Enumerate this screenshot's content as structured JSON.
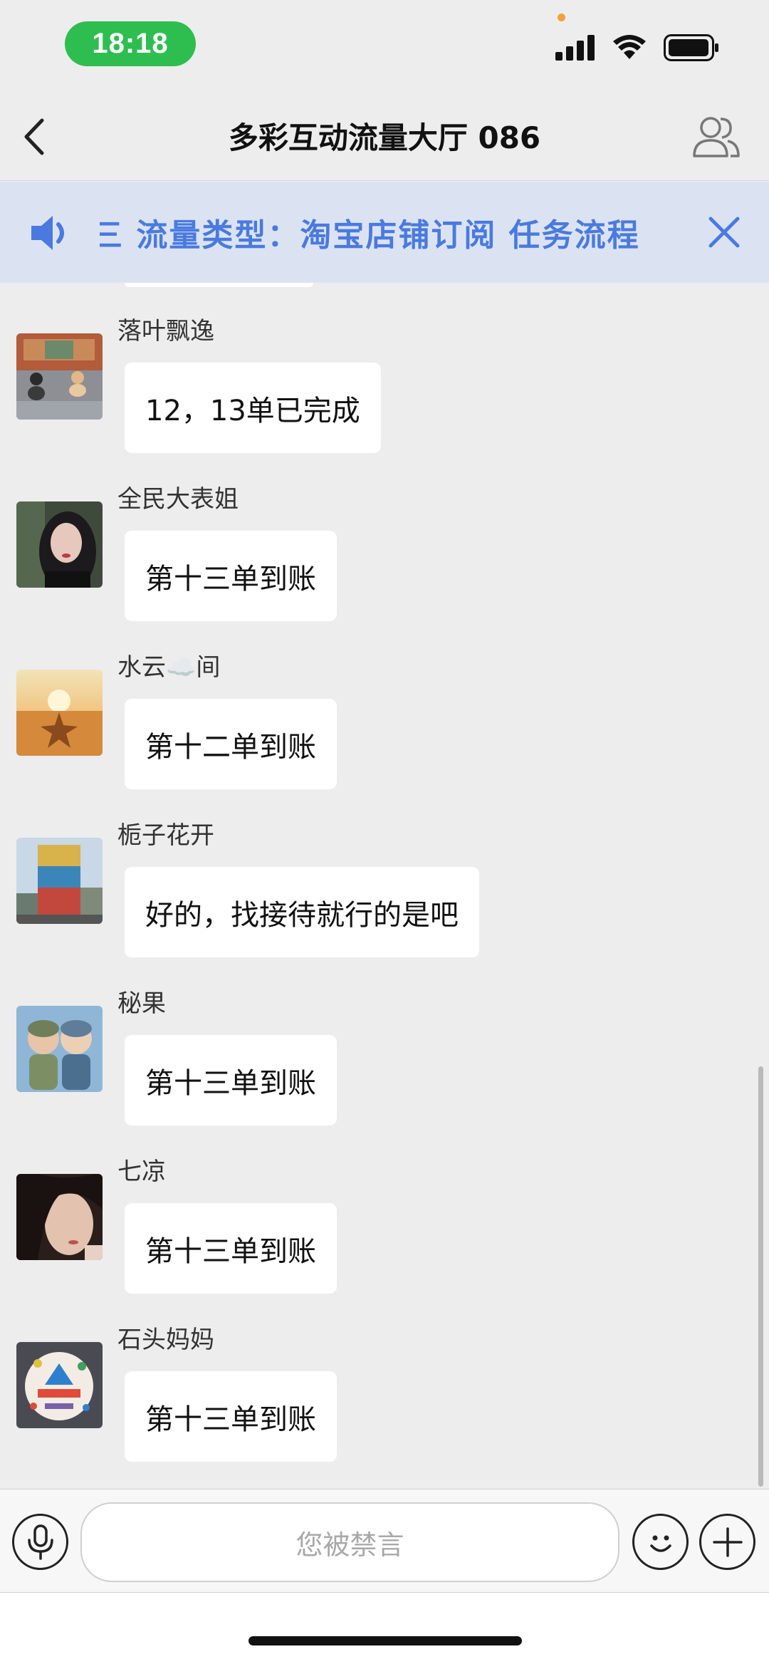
{
  "status_bar": {
    "time": "18:18"
  },
  "header": {
    "title": "多彩互动流量大厅 086"
  },
  "notice": {
    "text": "三  流量类型：淘宝店铺订阅  任务流程"
  },
  "messages": [
    {
      "sender": "落叶飘逸",
      "text": "12，13单已完成"
    },
    {
      "sender": "全民大表姐",
      "text": "第十三单到账"
    },
    {
      "sender": "水云☁️间",
      "text": "第十二单到账"
    },
    {
      "sender": "栀子花开",
      "text": "好的，找接待就行的是吧"
    },
    {
      "sender": "秘果",
      "text": "第十三单到账"
    },
    {
      "sender": "七凉",
      "text": "第十三单到账"
    },
    {
      "sender": "石头妈妈",
      "text": "第十三单到账"
    }
  ],
  "input": {
    "placeholder": "您被禁言"
  },
  "colors": {
    "accent_green": "#2dbe4f",
    "notice_bg": "#dbe3f3",
    "notice_text": "#4a7ae0"
  }
}
